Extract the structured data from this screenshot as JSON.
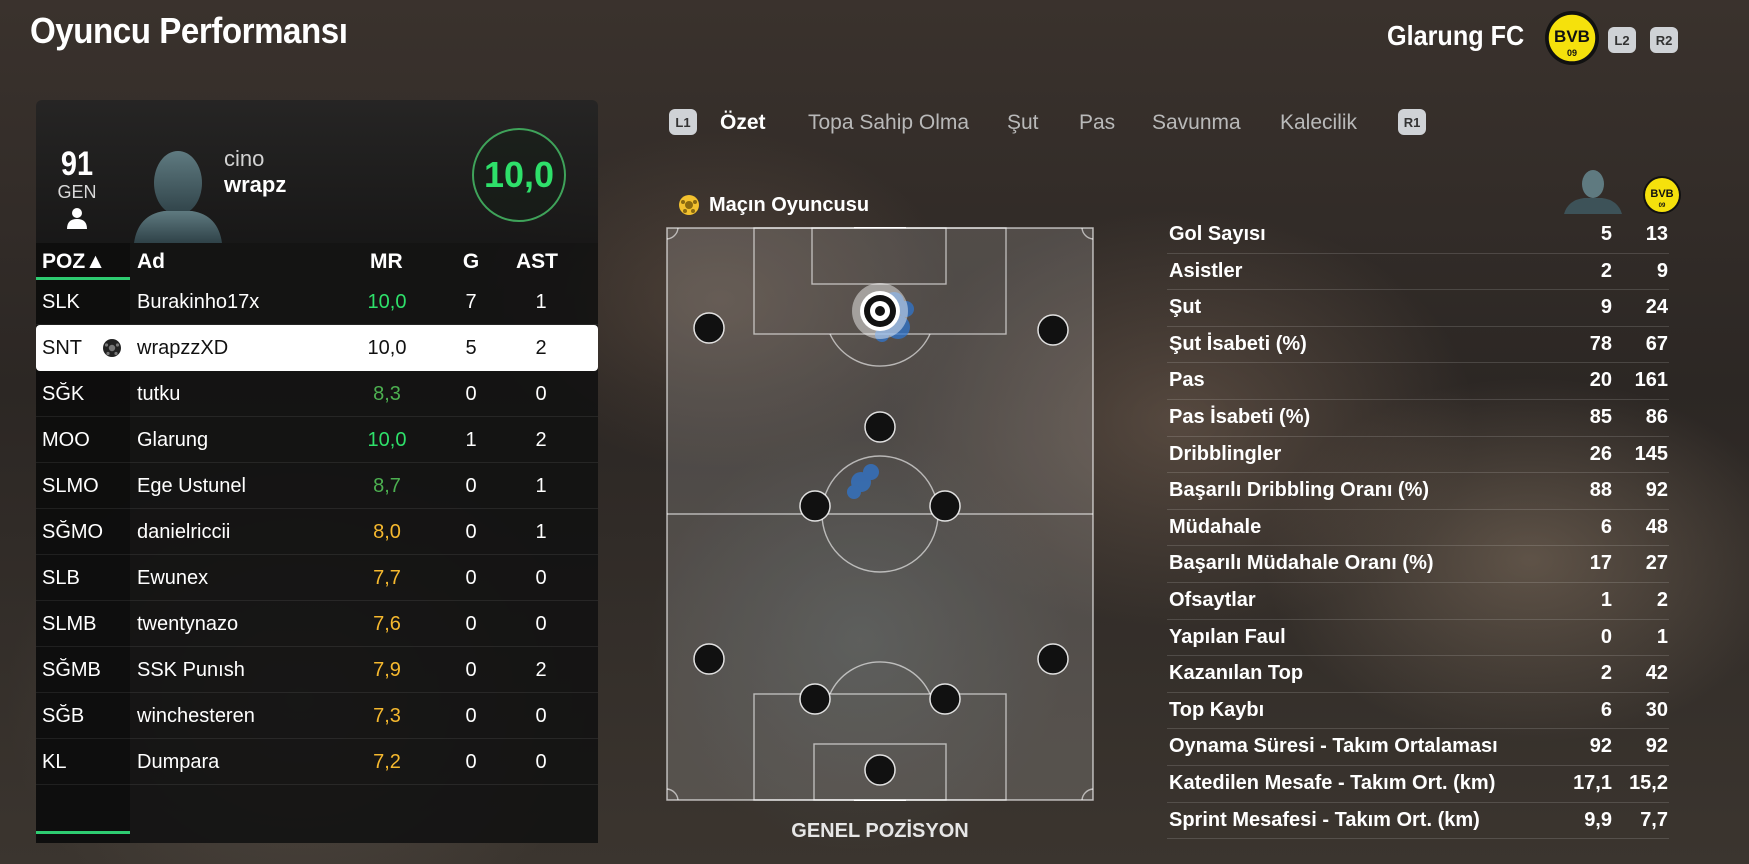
{
  "header": {
    "title": "Oyuncu Performansı",
    "club_name": "Glarung FC",
    "l2": "L2",
    "r2": "R2",
    "badge_text": "BVB",
    "badge_sub": "09"
  },
  "player": {
    "ovr": "91",
    "ovr_label": "GEN",
    "first_name": "cino",
    "last_name": "wrapz",
    "rating": "10,0"
  },
  "roster": {
    "headers": {
      "pos": "POZ▲",
      "name": "Ad",
      "mr": "MR",
      "g": "G",
      "ast": "AST"
    },
    "rows": [
      {
        "pos": "SLK",
        "name": "Burakinho17x",
        "mr": "10,0",
        "g": "7",
        "ast": "1"
      },
      {
        "pos": "SNT",
        "name": "wrapzzXD",
        "mr": "10,0",
        "g": "5",
        "ast": "2"
      },
      {
        "pos": "SĞK",
        "name": "tutku",
        "mr": "8,3",
        "g": "0",
        "ast": "0"
      },
      {
        "pos": "MOO",
        "name": "Glarung",
        "mr": "10,0",
        "g": "1",
        "ast": "2"
      },
      {
        "pos": "SLMO",
        "name": "Ege Ustunel",
        "mr": "8,7",
        "g": "0",
        "ast": "1"
      },
      {
        "pos": "SĞMO",
        "name": "danielriccii",
        "mr": "8,0",
        "g": "0",
        "ast": "1"
      },
      {
        "pos": "SLB",
        "name": "Ewunex",
        "mr": "7,7",
        "g": "0",
        "ast": "0"
      },
      {
        "pos": "SLMB",
        "name": "twentynazo",
        "mr": "7,6",
        "g": "0",
        "ast": "0"
      },
      {
        "pos": "SĞMB",
        "name": "SSK Punısh",
        "mr": "7,9",
        "g": "0",
        "ast": "2"
      },
      {
        "pos": "SĞB",
        "name": "winchesteren",
        "mr": "7,3",
        "g": "0",
        "ast": "0"
      },
      {
        "pos": "KL",
        "name": "Dumpara",
        "mr": "7,2",
        "g": "0",
        "ast": "0"
      }
    ],
    "rating_colors": {
      "top": "#2ee06a",
      "good": "#4caf50",
      "mid": "#f5b82e",
      "selected": "#111111"
    }
  },
  "tabs": {
    "l1": "L1",
    "r1": "R1",
    "items": [
      "Özet",
      "Topa Sahip Olma",
      "Şut",
      "Pas",
      "Savunma",
      "Kalecilik"
    ],
    "active": "Özet"
  },
  "pitch": {
    "motm_label": "Maçın Oyuncusu",
    "caption": "GENEL POZİSYON"
  },
  "stats": [
    {
      "label": "Gol Sayısı",
      "player": "5",
      "club": "13"
    },
    {
      "label": "Asistler",
      "player": "2",
      "club": "9"
    },
    {
      "label": "Şut",
      "player": "9",
      "club": "24"
    },
    {
      "label": "Şut İsabeti (%)",
      "player": "78",
      "club": "67"
    },
    {
      "label": "Pas",
      "player": "20",
      "club": "161"
    },
    {
      "label": "Pas İsabeti (%)",
      "player": "85",
      "club": "86"
    },
    {
      "label": "Dribblingler",
      "player": "26",
      "club": "145"
    },
    {
      "label": "Başarılı Dribbling Oranı (%)",
      "player": "88",
      "club": "92"
    },
    {
      "label": "Müdahale",
      "player": "6",
      "club": "48"
    },
    {
      "label": "Başarılı Müdahale Oranı (%)",
      "player": "17",
      "club": "27"
    },
    {
      "label": "Ofsaytlar",
      "player": "1",
      "club": "2"
    },
    {
      "label": "Yapılan Faul",
      "player": "0",
      "club": "1"
    },
    {
      "label": "Kazanılan Top",
      "player": "2",
      "club": "42"
    },
    {
      "label": "Top Kaybı",
      "player": "6",
      "club": "30"
    },
    {
      "label": "Oynama Süresi - Takım Ortalaması",
      "player": "92",
      "club": "92"
    },
    {
      "label": "Katedilen Mesafe - Takım Ort. (km)",
      "player": "17,1",
      "club": "15,2"
    },
    {
      "label": "Sprint Mesafesi - Takım Ort. (km)",
      "player": "9,9",
      "club": "7,7"
    }
  ]
}
